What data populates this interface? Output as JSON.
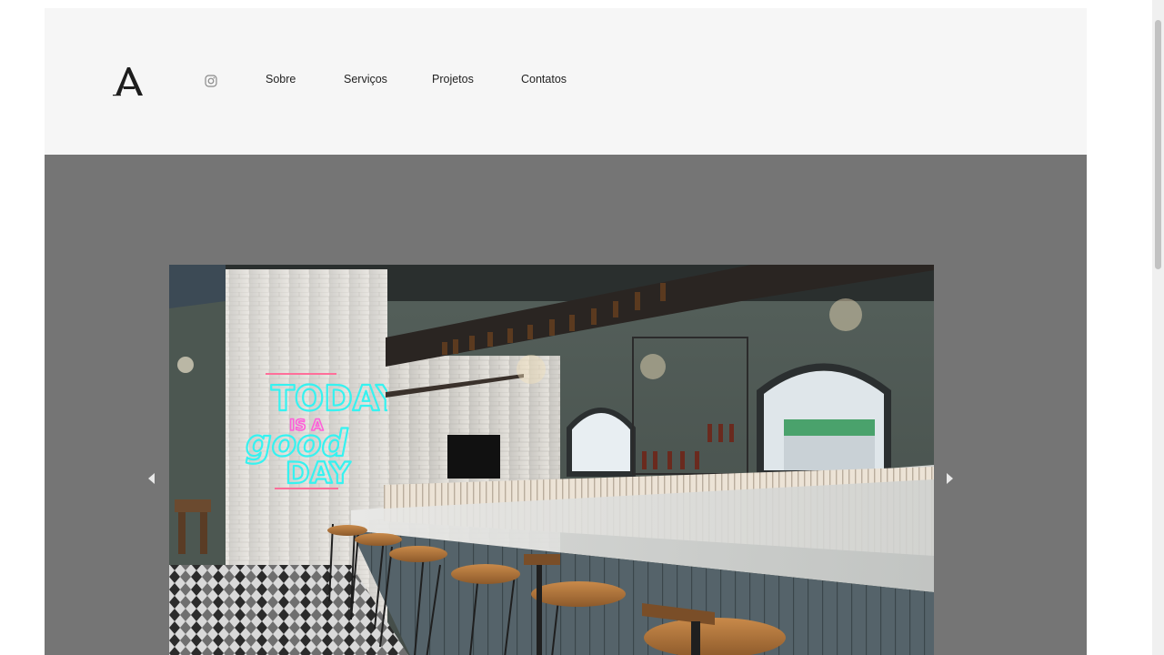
{
  "header": {
    "logo_letter": "A",
    "social": {
      "icon": "instagram-icon"
    },
    "nav": [
      {
        "label": "Sobre"
      },
      {
        "label": "Serviços"
      },
      {
        "label": "Projetos"
      },
      {
        "label": "Contatos"
      }
    ]
  },
  "hero": {
    "slide": {
      "neon_sign": [
        "TODAY",
        "IS A",
        "good",
        "DAY"
      ]
    },
    "prev_icon": "chevron-left-icon",
    "next_icon": "chevron-right-icon"
  },
  "colors": {
    "header_bg": "#f6f6f6",
    "hero_bg": "#757575",
    "neon_cyan": "#36f2f0",
    "neon_pink": "#ff5fd9"
  }
}
